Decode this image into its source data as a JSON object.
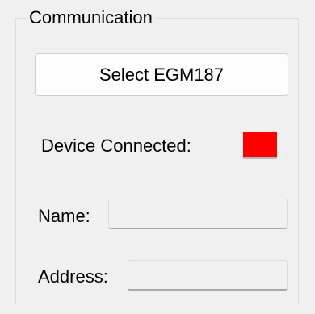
{
  "group": {
    "title": "Communication"
  },
  "select_button": {
    "label": "Select EGM187"
  },
  "device_connected": {
    "label": "Device Connected:",
    "status_color": "#ff0000"
  },
  "name": {
    "label": "Name:",
    "value": ""
  },
  "address": {
    "label": "Address:",
    "value": ""
  }
}
